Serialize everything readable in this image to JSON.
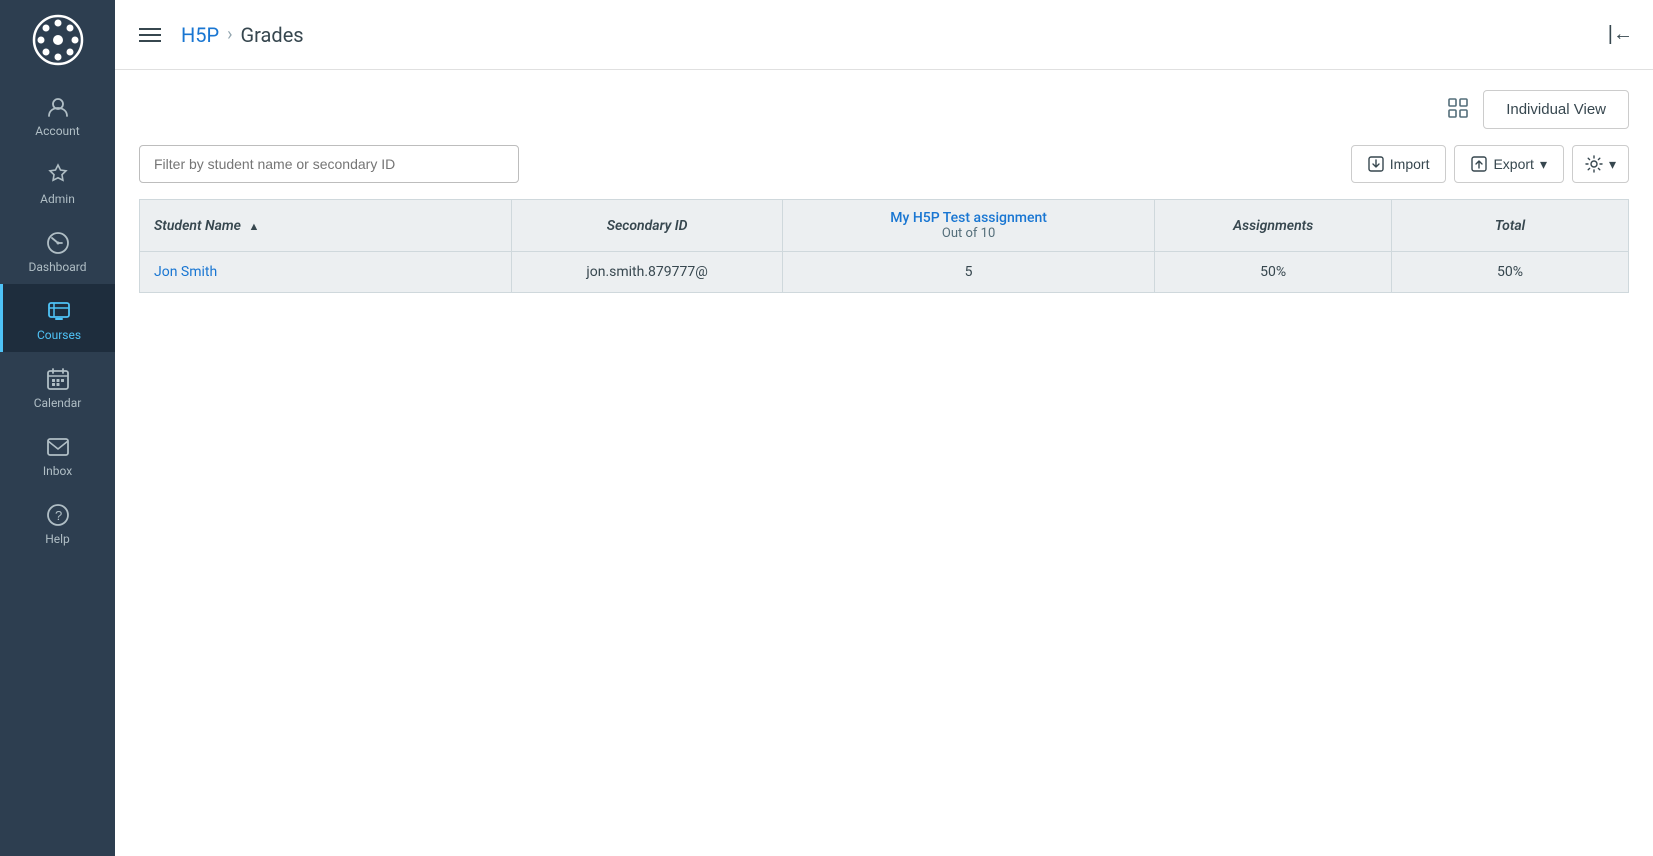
{
  "sidebar": {
    "logo_alt": "App Logo",
    "items": [
      {
        "id": "account",
        "label": "Account",
        "active": false
      },
      {
        "id": "admin",
        "label": "Admin",
        "active": false
      },
      {
        "id": "dashboard",
        "label": "Dashboard",
        "active": false
      },
      {
        "id": "courses",
        "label": "Courses",
        "active": true
      },
      {
        "id": "calendar",
        "label": "Calendar",
        "active": false
      },
      {
        "id": "inbox",
        "label": "Inbox",
        "active": false
      },
      {
        "id": "help",
        "label": "Help",
        "active": false
      }
    ]
  },
  "header": {
    "hamburger_label": "Menu",
    "breadcrumb_link": "H5P",
    "breadcrumb_sep": "›",
    "breadcrumb_current": "Grades",
    "collapse_label": "Collapse"
  },
  "toolbar": {
    "individual_view_label": "Individual View"
  },
  "filter": {
    "placeholder": "Filter by student name or secondary ID"
  },
  "actions": {
    "import_label": "Import",
    "export_label": "Export",
    "settings_label": "⚙"
  },
  "table": {
    "columns": {
      "student_name": "Student Name",
      "secondary_id": "Secondary ID",
      "assignment_name": "My H5P Test assignment",
      "assignment_sub": "Out of 10",
      "assignments": "Assignments",
      "total": "Total"
    },
    "rows": [
      {
        "student_name": "Jon Smith",
        "secondary_id": "jon.smith.879777@",
        "assignment_score": "5",
        "assignments": "50%",
        "total": "50%"
      }
    ]
  }
}
